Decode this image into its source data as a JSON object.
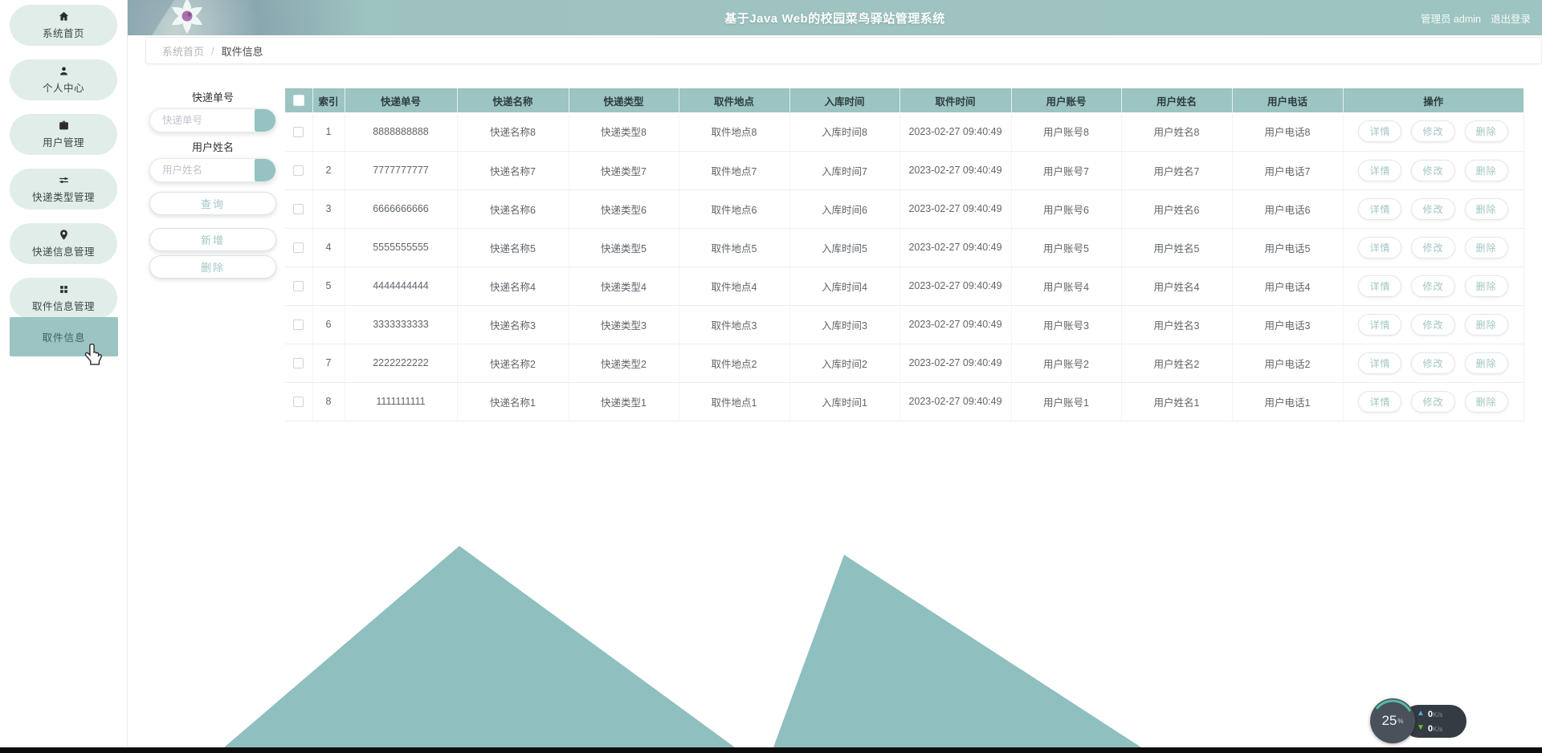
{
  "header": {
    "title": "基于Java Web的校园菜鸟驿站管理系统",
    "admin_label": "管理员 admin",
    "logout_label": "退出登录"
  },
  "breadcrumb": {
    "root": "系统首页",
    "separator": "/",
    "current": "取件信息"
  },
  "sidebar": {
    "items": [
      {
        "label": "系统首页",
        "icon": "home-icon"
      },
      {
        "label": "个人中心",
        "icon": "person-icon"
      },
      {
        "label": "用户管理",
        "icon": "briefcase-icon"
      },
      {
        "label": "快递类型管理",
        "icon": "sliders-icon"
      },
      {
        "label": "快递信息管理",
        "icon": "location-pin-icon"
      },
      {
        "label": "取件信息管理",
        "icon": "grid-icon"
      }
    ],
    "active_item": "取件信息"
  },
  "search": {
    "tracking_label": "快递单号",
    "tracking_placeholder": "快递单号",
    "name_label": "用户姓名",
    "name_placeholder": "用户姓名",
    "query_button": "查询",
    "add_button": "新增",
    "delete_button": "删除"
  },
  "table": {
    "headers": [
      "索引",
      "快递单号",
      "快递名称",
      "快递类型",
      "取件地点",
      "入库时间",
      "取件时间",
      "用户账号",
      "用户姓名",
      "用户电话",
      "操作"
    ],
    "actions": [
      "详情",
      "修改",
      "删除"
    ],
    "rows": [
      {
        "index": "1",
        "tracking_no": "8888888888",
        "express_name": "快递名称8",
        "express_type": "快递类型8",
        "pickup_location": "取件地点8",
        "store_time": "入库时间8",
        "pickup_time": "2023-02-27 09:40:49",
        "user_account": "用户账号8",
        "user_name": "用户姓名8",
        "user_phone": "用户电话8"
      },
      {
        "index": "2",
        "tracking_no": "7777777777",
        "express_name": "快递名称7",
        "express_type": "快递类型7",
        "pickup_location": "取件地点7",
        "store_time": "入库时间7",
        "pickup_time": "2023-02-27 09:40:49",
        "user_account": "用户账号7",
        "user_name": "用户姓名7",
        "user_phone": "用户电话7"
      },
      {
        "index": "3",
        "tracking_no": "6666666666",
        "express_name": "快递名称6",
        "express_type": "快递类型6",
        "pickup_location": "取件地点6",
        "store_time": "入库时间6",
        "pickup_time": "2023-02-27 09:40:49",
        "user_account": "用户账号6",
        "user_name": "用户姓名6",
        "user_phone": "用户电话6"
      },
      {
        "index": "4",
        "tracking_no": "5555555555",
        "express_name": "快递名称5",
        "express_type": "快递类型5",
        "pickup_location": "取件地点5",
        "store_time": "入库时间5",
        "pickup_time": "2023-02-27 09:40:49",
        "user_account": "用户账号5",
        "user_name": "用户姓名5",
        "user_phone": "用户电话5"
      },
      {
        "index": "5",
        "tracking_no": "4444444444",
        "express_name": "快递名称4",
        "express_type": "快递类型4",
        "pickup_location": "取件地点4",
        "store_time": "入库时间4",
        "pickup_time": "2023-02-27 09:40:49",
        "user_account": "用户账号4",
        "user_name": "用户姓名4",
        "user_phone": "用户电话4"
      },
      {
        "index": "6",
        "tracking_no": "3333333333",
        "express_name": "快递名称3",
        "express_type": "快递类型3",
        "pickup_location": "取件地点3",
        "store_time": "入库时间3",
        "pickup_time": "2023-02-27 09:40:49",
        "user_account": "用户账号3",
        "user_name": "用户姓名3",
        "user_phone": "用户电话3"
      },
      {
        "index": "7",
        "tracking_no": "2222222222",
        "express_name": "快递名称2",
        "express_type": "快递类型2",
        "pickup_location": "取件地点2",
        "store_time": "入库时间2",
        "pickup_time": "2023-02-27 09:40:49",
        "user_account": "用户账号2",
        "user_name": "用户姓名2",
        "user_phone": "用户电话2"
      },
      {
        "index": "8",
        "tracking_no": "1111111111",
        "express_name": "快递名称1",
        "express_type": "快递类型1",
        "pickup_location": "取件地点1",
        "store_time": "入库时间1",
        "pickup_time": "2023-02-27 09:40:49",
        "user_account": "用户账号1",
        "user_name": "用户姓名1",
        "user_phone": "用户电话1"
      }
    ]
  },
  "speed_widget": {
    "percent": "25",
    "percent_unit": "%",
    "upload_value": "0",
    "download_value": "0",
    "speed_unit": "K/s"
  },
  "colors": {
    "accent_teal": "#9bc4c3",
    "mountain_teal": "#8fbfbf",
    "sidebar_pill": "#e1ede8",
    "upload_arrow": "#5aa7e8",
    "download_arrow": "#67c23a"
  }
}
